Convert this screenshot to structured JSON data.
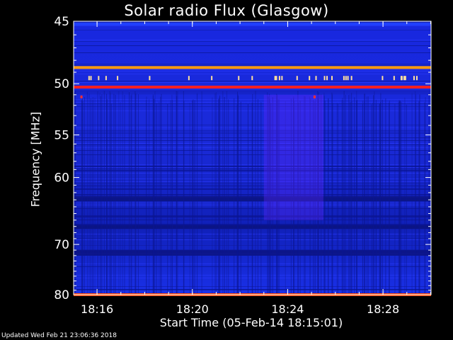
{
  "chart_data": {
    "type": "heatmap",
    "title": "Solar radio Flux (Glasgow)",
    "ylabel": "Frequency [MHz]",
    "xlabel": "Start Time (05-Feb-14 18:15:01)",
    "x_ticks": [
      "18:16",
      "18:20",
      "18:24",
      "18:28"
    ],
    "y_ticks": [
      45,
      50,
      55,
      60,
      70,
      80
    ],
    "ylim": [
      45,
      80
    ],
    "xlim": [
      "18:15:01",
      "18:30:01"
    ],
    "y_scale": "reciprocal",
    "grid": false,
    "colormap": [
      "#000050",
      "#1020c8",
      "#3040ff",
      "#8040ff",
      "#ff2020",
      "#ffd040",
      "#ffffff"
    ],
    "background_color": "#1828d8",
    "features": [
      {
        "kind": "horizontal_band",
        "frequency_mhz": 48.6,
        "color": "#ff9a10"
      },
      {
        "kind": "horizontal_band",
        "frequency_mhz": 50.3,
        "color": "#ff2020"
      },
      {
        "kind": "horizontal_band",
        "frequency_mhz": 80.0,
        "color": "#ff5010"
      },
      {
        "kind": "horizontal_band",
        "frequency_mhz": 45.2,
        "color": "#2040ff"
      }
    ],
    "enhanced_region": {
      "time_start": "18:23:00",
      "time_end": "18:25:30",
      "freq_low": 51,
      "freq_high": 66,
      "color": "#6028ff"
    }
  },
  "footer": "Updated Wed Feb 21 23:06:36 2018"
}
